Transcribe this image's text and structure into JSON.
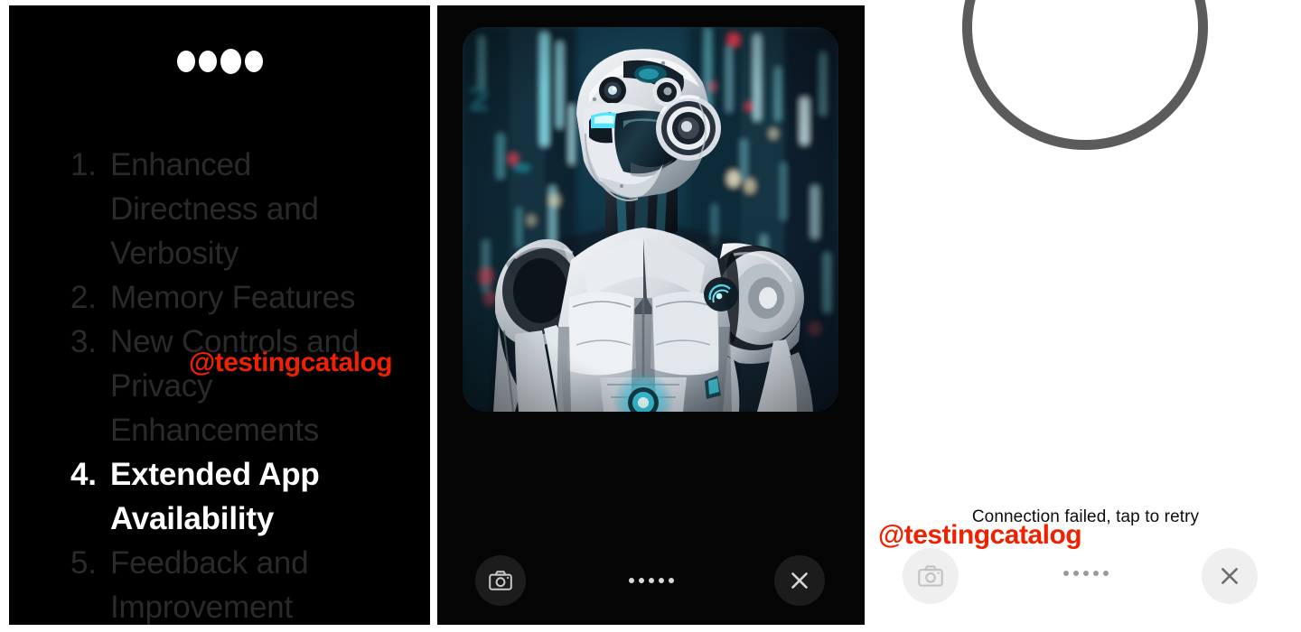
{
  "panels": {
    "left": {
      "name": "chat-response-screen",
      "typing_indicator": {
        "icon": "typing-dots-icon",
        "dot_count": 4
      },
      "list_items": [
        {
          "num": "1.",
          "text": "Enhanced Directness and Verbosity",
          "active": false
        },
        {
          "num": "2.",
          "text": "Memory Features",
          "active": false
        },
        {
          "num": "3.",
          "text": "New Controls and Privacy Enhancements",
          "active": false
        },
        {
          "num": "4.",
          "text": "Extended App Availability",
          "active": true
        },
        {
          "num": "5.",
          "text": "Feedback and Improvement",
          "active": false
        }
      ],
      "watermark": "@testingcatalog"
    },
    "middle": {
      "name": "image-preview-screen",
      "image_alt": "futuristic white humanoid robot in neon cyberpunk city",
      "camera_button": "camera-icon",
      "close_button": "close-icon",
      "page_dots": 5
    },
    "right": {
      "name": "connection-error-screen",
      "spinner": "loading-spinner-ring",
      "error_message": "Connection failed, tap to retry",
      "watermark": "@testingcatalog",
      "camera_button": "camera-icon",
      "close_button": "close-icon",
      "page_dots": 5
    }
  },
  "colors": {
    "panel_dark_bg": "#000000",
    "inactive_text": "#2a2a2a",
    "active_text": "#ffffff",
    "watermark_red": "#ee2200",
    "spinner_gray": "#5b5b5b",
    "error_text": "#0d0d0d",
    "light_button_bg": "#efefef",
    "dark_button_bg": "#1c1c1c"
  }
}
